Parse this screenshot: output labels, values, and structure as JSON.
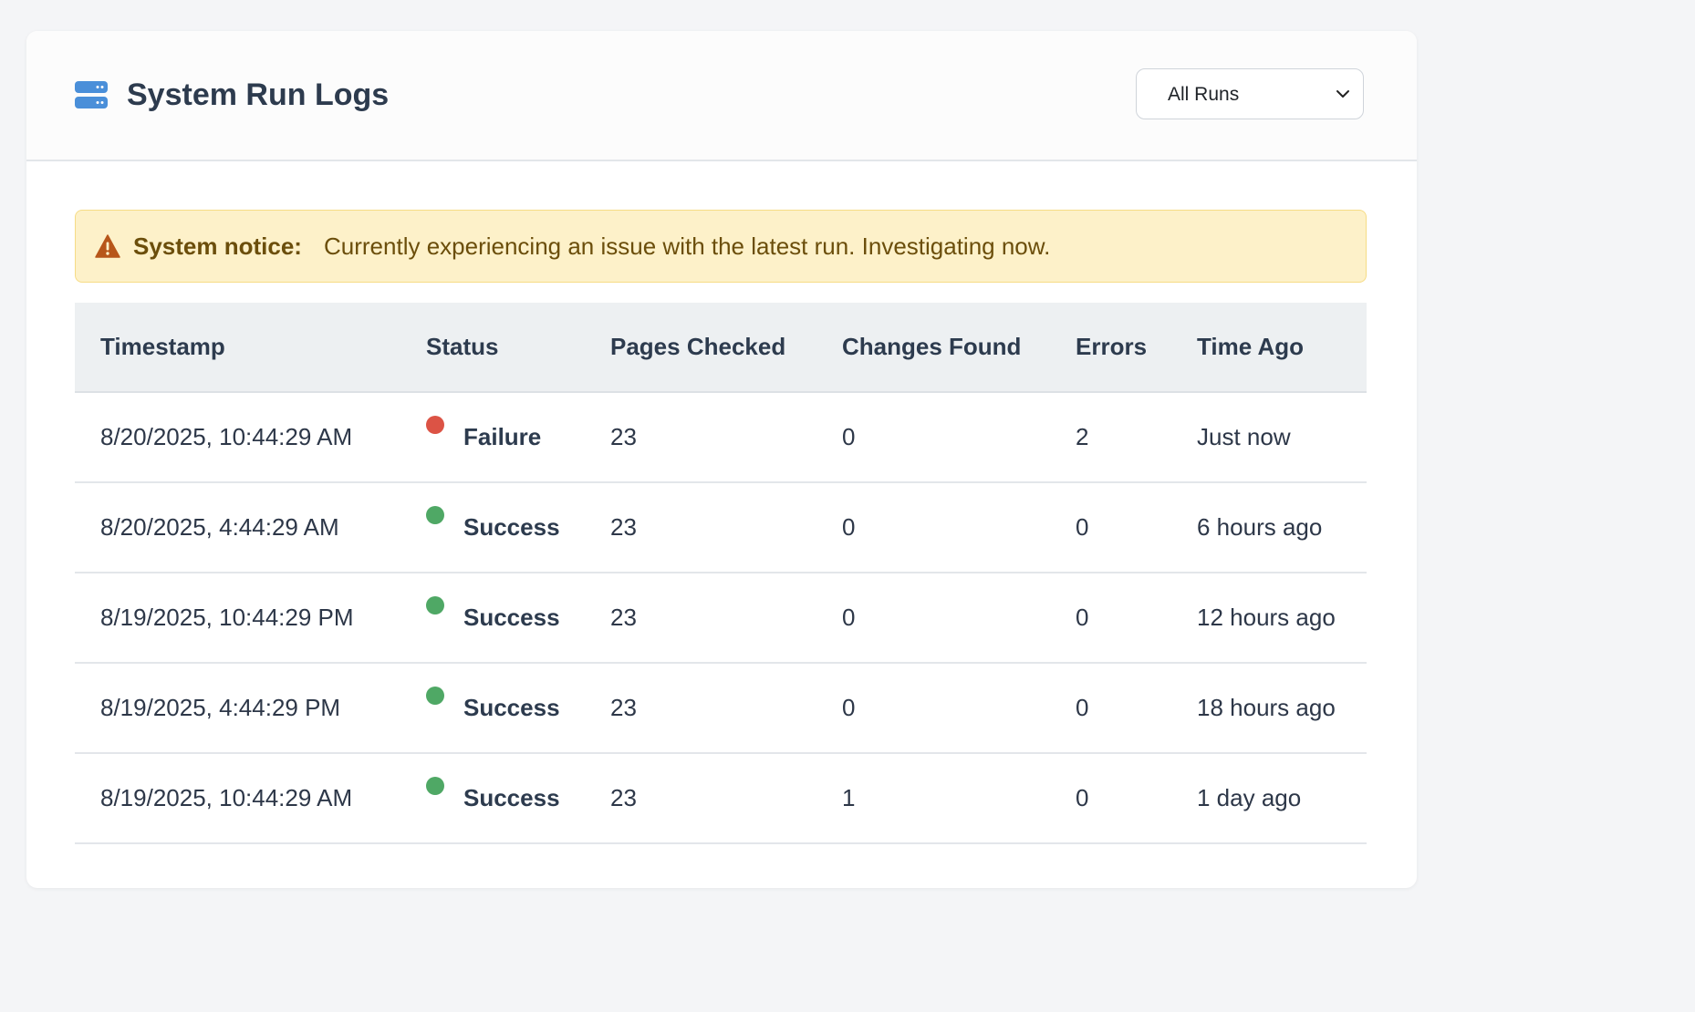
{
  "header": {
    "title": "System Run Logs",
    "icon": "server-icon",
    "filter": {
      "selected": "All Runs"
    }
  },
  "notice": {
    "label": "System notice:",
    "text": "Currently experiencing an issue with the latest run. Investigating now.",
    "icon": "warning-icon"
  },
  "table": {
    "columns": [
      "Timestamp",
      "Status",
      "Pages Checked",
      "Changes Found",
      "Errors",
      "Time Ago"
    ],
    "rows": [
      {
        "timestamp": "8/20/2025, 10:44:29 AM",
        "status": "Failure",
        "pages": "23",
        "changes": "0",
        "errors": "2",
        "ago": "Just now"
      },
      {
        "timestamp": "8/20/2025, 4:44:29 AM",
        "status": "Success",
        "pages": "23",
        "changes": "0",
        "errors": "0",
        "ago": "6 hours ago"
      },
      {
        "timestamp": "8/19/2025, 10:44:29 PM",
        "status": "Success",
        "pages": "23",
        "changes": "0",
        "errors": "0",
        "ago": "12 hours ago"
      },
      {
        "timestamp": "8/19/2025, 4:44:29 PM",
        "status": "Success",
        "pages": "23",
        "changes": "0",
        "errors": "0",
        "ago": "18 hours ago"
      },
      {
        "timestamp": "8/19/2025, 10:44:29 AM",
        "status": "Success",
        "pages": "23",
        "changes": "1",
        "errors": "0",
        "ago": "1 day ago"
      }
    ]
  },
  "colors": {
    "failure": "#dc5345",
    "success": "#4fa865",
    "accent": "#4a8fd9",
    "warning": "#b7561a"
  }
}
